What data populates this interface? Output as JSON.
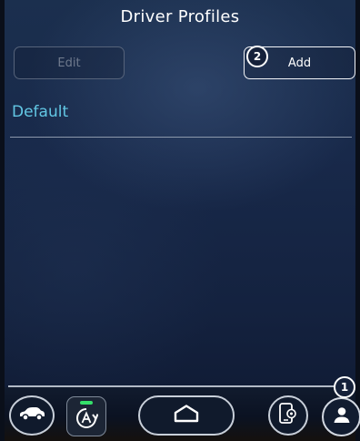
{
  "header": {
    "title": "Driver Profiles"
  },
  "toolbar": {
    "edit_label": "Edit",
    "add_label": "Add"
  },
  "profiles": [
    {
      "name": "Default"
    }
  ],
  "callouts": {
    "add": "2",
    "profile": "1"
  },
  "status": {
    "led_color": "#35e06a"
  },
  "bottom_nav": [
    {
      "icon": "car-icon"
    },
    {
      "icon": "auto-drive-icon"
    },
    {
      "icon": "home-icon"
    },
    {
      "icon": "phone-settings-icon"
    },
    {
      "icon": "profile-icon"
    }
  ]
}
